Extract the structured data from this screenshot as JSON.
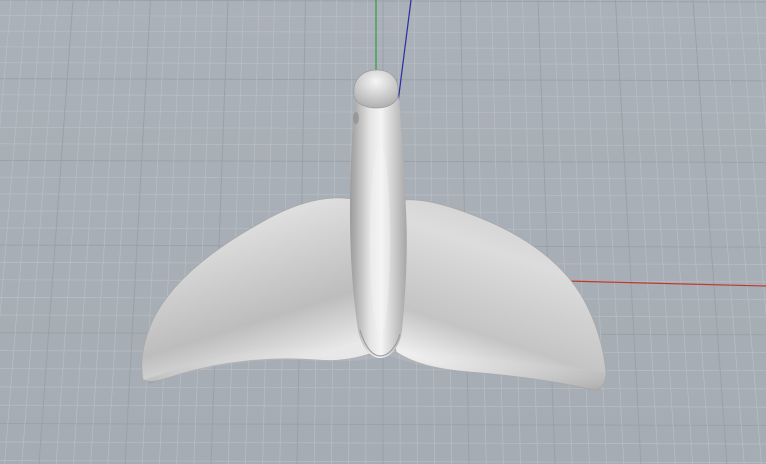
{
  "viewport": {
    "background": "#a8afb6",
    "grid_minor_color": "#b8bec4",
    "grid_major_color": "#9aa1a8",
    "axis_x_color": "#c0392b",
    "axis_y_color": "#2e9e3e",
    "axis_z_color": "#2b2f9e",
    "grid_visible": true
  },
  "model": {
    "object": "whale-tail-pendant",
    "material_color": "#d9d9d9",
    "shading": "rendered"
  }
}
